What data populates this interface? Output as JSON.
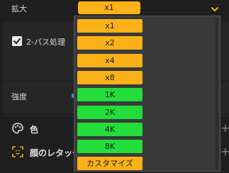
{
  "scale": {
    "label": "拡大",
    "selected": "x1",
    "selected_color": "#fbb117"
  },
  "two_pass": {
    "label": "2-パス処理",
    "checked": true
  },
  "strength": {
    "label": "強度"
  },
  "sections": [
    {
      "label": "色",
      "icon": "palette-icon"
    },
    {
      "label": "顔のレタッチ",
      "icon": "face-scan-icon"
    }
  ],
  "dropdown": {
    "options": [
      {
        "label": "x1",
        "color": "#fbb117"
      },
      {
        "label": "x2",
        "color": "#fbb117"
      },
      {
        "label": "x4",
        "color": "#fbb117"
      },
      {
        "label": "x8",
        "color": "#fbb117"
      },
      {
        "label": "1K",
        "color": "#22dd3a"
      },
      {
        "label": "2K",
        "color": "#22dd3a"
      },
      {
        "label": "4K",
        "color": "#22dd3a"
      },
      {
        "label": "8K",
        "color": "#22dd3a"
      },
      {
        "label": "カスタマイズ",
        "color": "#fbb117"
      }
    ]
  }
}
